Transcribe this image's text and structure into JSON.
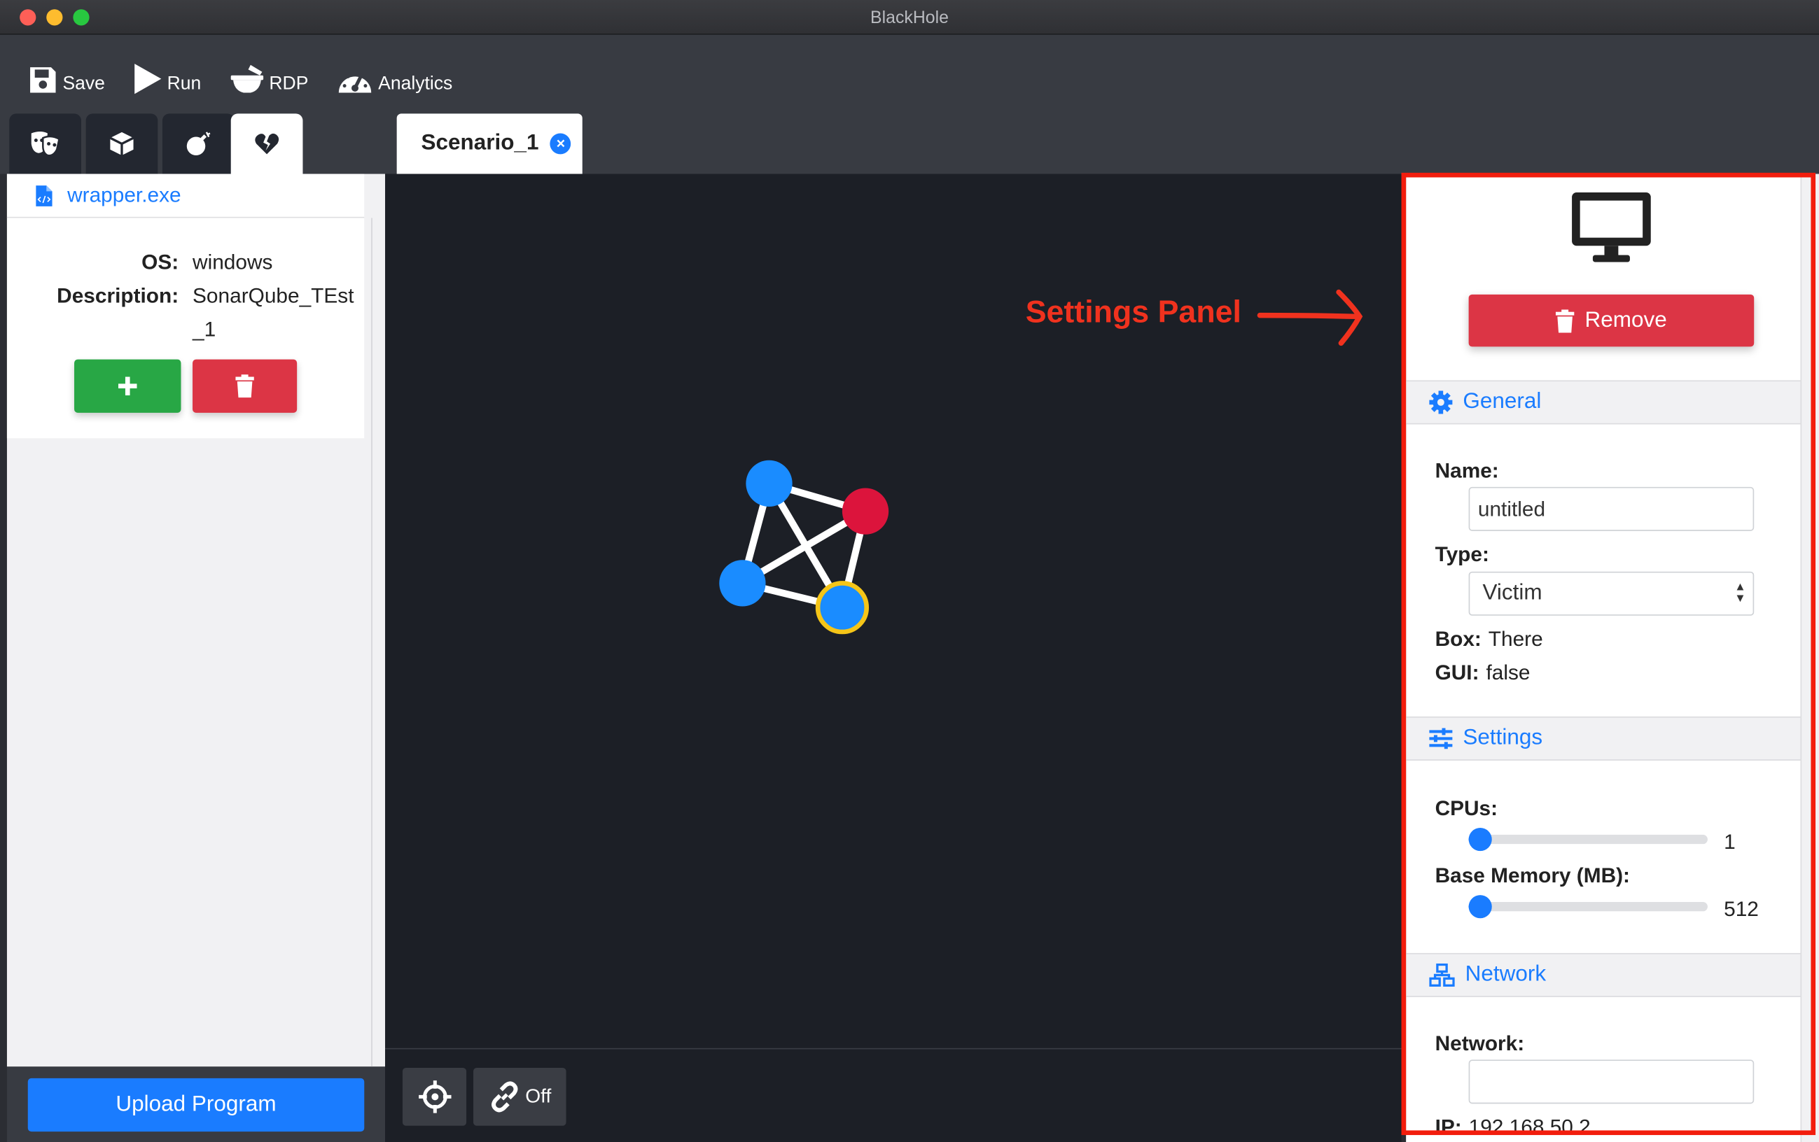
{
  "window": {
    "title": "BlackHole",
    "traffic_colors": [
      "#fe5f57",
      "#febc2e",
      "#28c840"
    ]
  },
  "toolbar": {
    "save_label": "Save",
    "run_label": "Run",
    "rdp_label": "RDP",
    "analytics_label": "Analytics"
  },
  "side_tabs": [
    {
      "icon": "theater-masks-icon",
      "active": false
    },
    {
      "icon": "cube-icon",
      "active": false
    },
    {
      "icon": "bomb-icon",
      "active": false
    },
    {
      "icon": "heart-broken-icon",
      "active": true
    }
  ],
  "scenario_tab": {
    "label": "Scenario_1",
    "close_icon": "close-circle-icon"
  },
  "left_panel": {
    "file_name": "wrapper.exe",
    "file_icon": "code-file-icon",
    "os_label": "OS:",
    "os_value": "windows",
    "description_label": "Description:",
    "description_value": "SonarQube_TEst_1",
    "add_icon": "plus-icon",
    "delete_icon": "trash-icon",
    "upload_label": "Upload Program"
  },
  "canvas": {
    "annotation": "Settings Panel",
    "nodes": [
      {
        "name": "node-top",
        "color": "#1a8cff"
      },
      {
        "name": "node-right",
        "color": "#dc143c"
      },
      {
        "name": "node-left",
        "color": "#1a8cff"
      },
      {
        "name": "node-selected",
        "color": "#1a8cff",
        "ring": "#f5c518"
      }
    ],
    "center_label": "",
    "link_toggle_label": "Off"
  },
  "settings": {
    "remove_label": "Remove",
    "general_title": "General",
    "name_label": "Name:",
    "name_value": "untitled",
    "type_label": "Type:",
    "type_value": "Victim",
    "box_label": "Box:",
    "box_value": "There",
    "gui_label": "GUI:",
    "gui_value": "false",
    "settings_title": "Settings",
    "cpus_label": "CPUs:",
    "cpus_value": "1",
    "cpus_fraction": 0.0,
    "memory_label": "Base Memory (MB):",
    "memory_value": "512",
    "memory_fraction": 0.0,
    "network_title": "Network",
    "network_label": "Network:",
    "network_value": "",
    "ip_label": "IP:",
    "ip_value": "192.168.50.2"
  },
  "colors": {
    "accent": "#1a7cff",
    "danger": "#dc3545",
    "success": "#28a745",
    "annotation": "#f0321e"
  }
}
